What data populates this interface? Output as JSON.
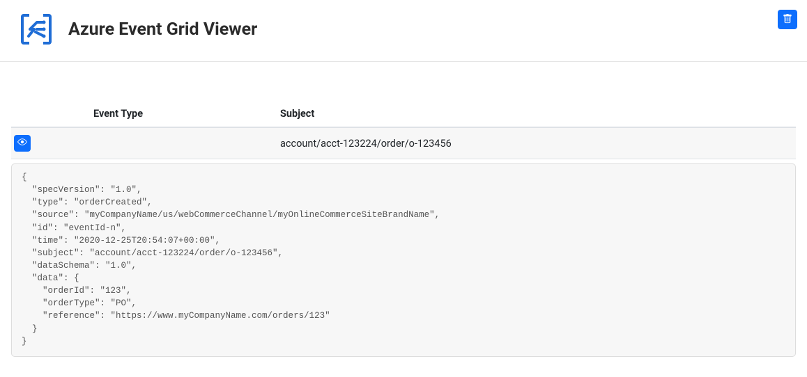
{
  "header": {
    "title": "Azure Event Grid Viewer"
  },
  "table": {
    "columns": {
      "event_type": "Event Type",
      "subject": "Subject"
    },
    "rows": [
      {
        "event_type": "",
        "subject": "account/acct-123224/order/o-123456"
      }
    ]
  },
  "detail_json": "{\n  \"specVersion\": \"1.0\",\n  \"type\": \"orderCreated\",\n  \"source\": \"myCompanyName/us/webCommerceChannel/myOnlineCommerceSiteBrandName\",\n  \"id\": \"eventId-n\",\n  \"time\": \"2020-12-25T20:54:07+00:00\",\n  \"subject\": \"account/acct-123224/order/o-123456\",\n  \"dataSchema\": \"1.0\",\n  \"data\": {\n    \"orderId\": \"123\",\n    \"orderType\": \"PO\",\n    \"reference\": \"https://www.myCompanyName.com/orders/123\"\n  }\n}"
}
